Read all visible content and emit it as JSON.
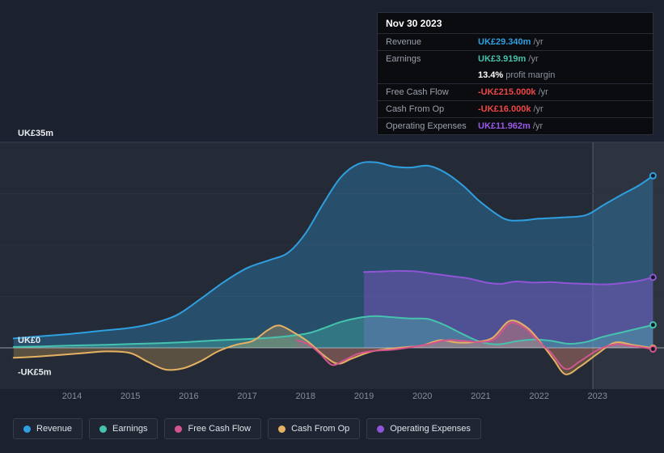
{
  "tooltip": {
    "date": "Nov 30 2023",
    "rows": [
      {
        "label": "Revenue",
        "value": "UK£29.340m",
        "suffix": " /yr",
        "color": "#2f9fe0"
      },
      {
        "label": "Earnings",
        "value": "UK£3.919m",
        "suffix": " /yr",
        "color": "#46c3ae"
      },
      {
        "label": "",
        "value": "13.4%",
        "suffix": " profit margin",
        "color": "#ffffff"
      },
      {
        "label": "Free Cash Flow",
        "value": "-UK£215.000k",
        "suffix": " /yr",
        "color": "#ef4646"
      },
      {
        "label": "Cash From Op",
        "value": "-UK£16.000k",
        "suffix": " /yr",
        "color": "#ef4646"
      },
      {
        "label": "Operating Expenses",
        "value": "UK£11.962m",
        "suffix": " /yr",
        "color": "#9b59e6"
      }
    ]
  },
  "legend": {
    "items": [
      {
        "label": "Revenue",
        "color": "#2f9fe0"
      },
      {
        "label": "Earnings",
        "color": "#46c3ae"
      },
      {
        "label": "Free Cash Flow",
        "color": "#d4548e"
      },
      {
        "label": "Cash From Op",
        "color": "#e5b162"
      },
      {
        "label": "Operating Expenses",
        "color": "#8f55d6"
      }
    ]
  },
  "chart_data": {
    "type": "area",
    "title": "Financial history: revenue, earnings, free cash flow, cash from op, operating expenses",
    "x_label_years": [
      2014,
      2015,
      2016,
      2017,
      2018,
      2019,
      2020,
      2021,
      2022,
      2023
    ],
    "x_range": [
      2013.0,
      2023.95
    ],
    "y_axis": {
      "top_label": "UK£35m",
      "zero_label": "UK£0",
      "neg_label": "-UK£5m",
      "max": 35,
      "min": -7,
      "unit": "UK£m"
    },
    "gridlines_m": [
      35,
      26.25,
      17.5,
      8.75
    ],
    "highlight_start": 2022.92,
    "colors": {
      "page_bg": "#1b212e",
      "plot_bg": "#242b37",
      "grid": "#2c3340",
      "grid_top": "#3a4150",
      "zero_line": "rgba(220,228,235,0.6)",
      "axis_text": "#878e99",
      "y_text": "#e8ebef"
    },
    "series": [
      {
        "name": "Revenue",
        "color": "#2f9fe0",
        "fill_opacity": 0.3,
        "draw_order": 0,
        "points": [
          [
            2013.0,
            1.6
          ],
          [
            2013.5,
            2.0
          ],
          [
            2014,
            2.4
          ],
          [
            2014.5,
            2.9
          ],
          [
            2015,
            3.4
          ],
          [
            2015.4,
            4.2
          ],
          [
            2015.8,
            5.6
          ],
          [
            2016.2,
            8.3
          ],
          [
            2016.6,
            11.2
          ],
          [
            2017,
            13.6
          ],
          [
            2017.4,
            15.0
          ],
          [
            2017.7,
            16.2
          ],
          [
            2018,
            19.5
          ],
          [
            2018.3,
            24.5
          ],
          [
            2018.6,
            29.0
          ],
          [
            2018.9,
            31.3
          ],
          [
            2019.2,
            31.6
          ],
          [
            2019.5,
            30.9
          ],
          [
            2019.8,
            30.7
          ],
          [
            2020.1,
            31.0
          ],
          [
            2020.4,
            29.8
          ],
          [
            2020.7,
            27.6
          ],
          [
            2021,
            24.8
          ],
          [
            2021.4,
            22.0
          ],
          [
            2021.7,
            21.7
          ],
          [
            2022,
            22.0
          ],
          [
            2022.4,
            22.2
          ],
          [
            2022.8,
            22.6
          ],
          [
            2023.1,
            24.3
          ],
          [
            2023.4,
            26.0
          ],
          [
            2023.7,
            27.6
          ],
          [
            2023.95,
            29.3
          ]
        ]
      },
      {
        "name": "Earnings",
        "color": "#46c3ae",
        "fill_opacity": 0.35,
        "draw_order": 2,
        "points": [
          [
            2013.0,
            0.15
          ],
          [
            2013.5,
            0.25
          ],
          [
            2014,
            0.4
          ],
          [
            2014.5,
            0.5
          ],
          [
            2015,
            0.65
          ],
          [
            2015.5,
            0.8
          ],
          [
            2016,
            1.0
          ],
          [
            2016.5,
            1.3
          ],
          [
            2017,
            1.5
          ],
          [
            2017.5,
            1.8
          ],
          [
            2018,
            2.4
          ],
          [
            2018.3,
            3.3
          ],
          [
            2018.6,
            4.4
          ],
          [
            2018.9,
            5.1
          ],
          [
            2019.2,
            5.4
          ],
          [
            2019.5,
            5.2
          ],
          [
            2019.8,
            5.0
          ],
          [
            2020.1,
            4.9
          ],
          [
            2020.4,
            3.8
          ],
          [
            2020.7,
            2.3
          ],
          [
            2021,
            1.0
          ],
          [
            2021.3,
            0.6
          ],
          [
            2021.6,
            1.1
          ],
          [
            2021.9,
            1.4
          ],
          [
            2022.2,
            1.2
          ],
          [
            2022.5,
            0.7
          ],
          [
            2022.8,
            1.0
          ],
          [
            2023.1,
            1.9
          ],
          [
            2023.4,
            2.6
          ],
          [
            2023.7,
            3.3
          ],
          [
            2023.95,
            3.9
          ]
        ]
      },
      {
        "name": "Free Cash Flow",
        "color": "#d4548e",
        "fill_opacity": 0.18,
        "draw_order": 4,
        "points": [
          [
            2017.85,
            1.3
          ],
          [
            2018.05,
            0.6
          ],
          [
            2018.25,
            -1.0
          ],
          [
            2018.45,
            -2.9
          ],
          [
            2018.65,
            -2.2
          ],
          [
            2018.9,
            -1.0
          ],
          [
            2019.2,
            -0.5
          ],
          [
            2019.5,
            -0.3
          ],
          [
            2019.8,
            0.1
          ],
          [
            2020.1,
            0.6
          ],
          [
            2020.4,
            1.3
          ],
          [
            2020.7,
            1.2
          ],
          [
            2021,
            1.0
          ],
          [
            2021.25,
            1.6
          ],
          [
            2021.5,
            4.2
          ],
          [
            2021.75,
            3.4
          ],
          [
            2022,
            1.0
          ],
          [
            2022.2,
            -0.8
          ],
          [
            2022.45,
            -3.6
          ],
          [
            2022.7,
            -2.3
          ],
          [
            2023,
            -0.4
          ],
          [
            2023.3,
            0.6
          ],
          [
            2023.6,
            0.3
          ],
          [
            2023.95,
            -0.2
          ]
        ]
      },
      {
        "name": "Cash From Op",
        "color": "#e5b162",
        "fill_opacity": 0.28,
        "draw_order": 3,
        "points": [
          [
            2013.0,
            -1.7
          ],
          [
            2013.4,
            -1.5
          ],
          [
            2013.8,
            -1.2
          ],
          [
            2014.2,
            -0.9
          ],
          [
            2014.6,
            -0.6
          ],
          [
            2015,
            -0.9
          ],
          [
            2015.3,
            -2.4
          ],
          [
            2015.6,
            -3.7
          ],
          [
            2015.9,
            -3.5
          ],
          [
            2016.2,
            -2.3
          ],
          [
            2016.5,
            -0.6
          ],
          [
            2016.8,
            0.5
          ],
          [
            2017.1,
            1.2
          ],
          [
            2017.35,
            3.0
          ],
          [
            2017.55,
            3.8
          ],
          [
            2017.8,
            2.6
          ],
          [
            2018.05,
            1.0
          ],
          [
            2018.3,
            -1.2
          ],
          [
            2018.55,
            -2.7
          ],
          [
            2018.8,
            -1.8
          ],
          [
            2019.1,
            -0.7
          ],
          [
            2019.4,
            -0.2
          ],
          [
            2019.7,
            0.1
          ],
          [
            2020,
            0.4
          ],
          [
            2020.3,
            1.3
          ],
          [
            2020.6,
            0.9
          ],
          [
            2020.9,
            1.0
          ],
          [
            2021.2,
            1.7
          ],
          [
            2021.5,
            4.6
          ],
          [
            2021.8,
            3.4
          ],
          [
            2022.05,
            0.6
          ],
          [
            2022.25,
            -2.0
          ],
          [
            2022.45,
            -4.5
          ],
          [
            2022.7,
            -3.2
          ],
          [
            2023,
            -1.0
          ],
          [
            2023.3,
            0.9
          ],
          [
            2023.6,
            0.5
          ],
          [
            2023.95,
            -0.05
          ]
        ]
      },
      {
        "name": "Operating Expenses",
        "color": "#8f55d6",
        "fill_opacity": 0.4,
        "draw_order": 1,
        "points": [
          [
            2019,
            12.9
          ],
          [
            2019.3,
            13.0
          ],
          [
            2019.6,
            13.1
          ],
          [
            2019.9,
            13.0
          ],
          [
            2020.2,
            12.6
          ],
          [
            2020.5,
            12.2
          ],
          [
            2020.8,
            11.8
          ],
          [
            2021.1,
            11.1
          ],
          [
            2021.35,
            10.9
          ],
          [
            2021.6,
            11.3
          ],
          [
            2021.9,
            11.1
          ],
          [
            2022.2,
            11.2
          ],
          [
            2022.5,
            11.0
          ],
          [
            2022.8,
            10.9
          ],
          [
            2023.1,
            10.8
          ],
          [
            2023.4,
            11.0
          ],
          [
            2023.7,
            11.4
          ],
          [
            2023.95,
            12.0
          ]
        ]
      }
    ]
  }
}
